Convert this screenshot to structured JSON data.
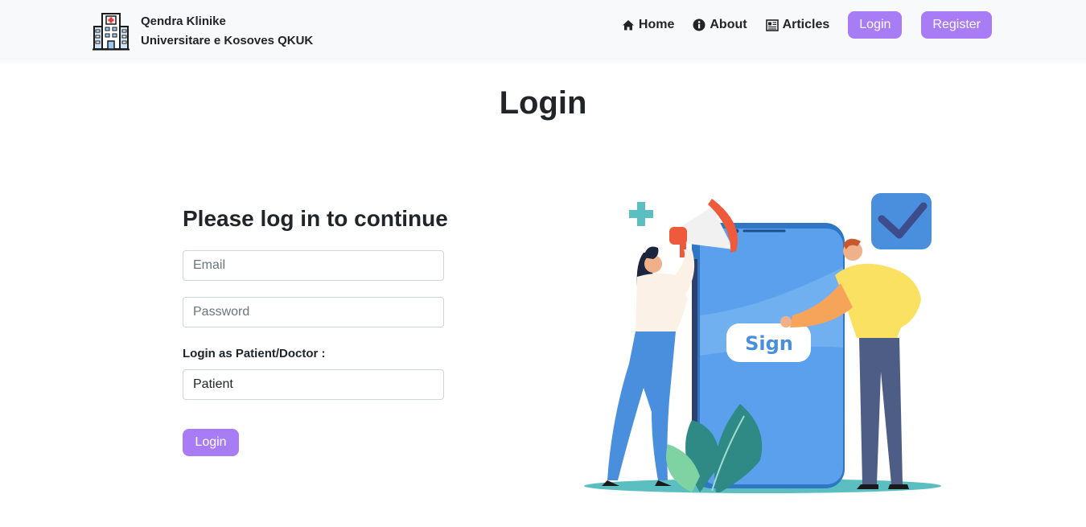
{
  "brand": {
    "line1": "Qendra Klinike",
    "line2": "Universitare e Kosoves QKUK",
    "logo_icon": "hospital-icon"
  },
  "nav": {
    "home": "Home",
    "about": "About",
    "articles": "Articles",
    "login_button": "Login",
    "register_button": "Register"
  },
  "colors": {
    "accent": "#a87cf4",
    "navbar_bg": "#f8f9fa"
  },
  "page": {
    "title": "Login"
  },
  "form": {
    "heading": "Please log in to continue",
    "email_placeholder": "Email",
    "password_placeholder": "Password",
    "role_label": "Login as Patient/Doctor :",
    "role_value": "Patient",
    "submit_label": "Login"
  },
  "illustration": {
    "sign_text": "Sign"
  }
}
